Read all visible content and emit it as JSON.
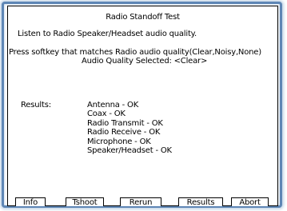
{
  "screen": {
    "title": "Radio Standoff Test",
    "instruction": "Listen to Radio Speaker/Headset audio quality.",
    "prompt": "Press softkey that matches Radio audio quality(Clear,Noisy,None)",
    "selection": "Audio Quality Selected: <Clear>",
    "results_label": "Results:",
    "results": [
      "Antenna - OK",
      "Coax - OK",
      "Radio Transmit - OK",
      "Radio Receive - OK",
      "Microphone - OK",
      "Speaker/Headset - OK"
    ]
  },
  "softkeys": [
    "Info",
    "Tshoot",
    "Rerun",
    "Results",
    "Abort"
  ],
  "colors": {
    "frame": "#5e86b5",
    "glow": "#c5d6e8",
    "text": "#000000",
    "background": "#ffffff"
  }
}
